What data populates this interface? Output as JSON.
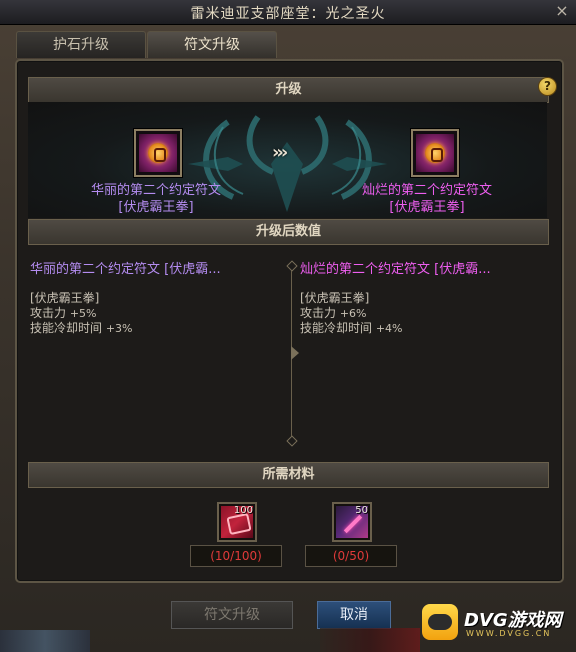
{
  "window": {
    "title": "雷米迪亚支部座堂：光之圣火"
  },
  "tabs": [
    {
      "label": "护石升级",
      "active": false
    },
    {
      "label": "符文升级",
      "active": true
    }
  ],
  "sections": {
    "upgrade": "升级",
    "after": "升级后数值",
    "materials": "所需材料"
  },
  "help_label": "?",
  "arrows": "›››",
  "source_item": {
    "name_lines": [
      "华丽的第二个约定符文",
      "[伏虎霸王拳]"
    ],
    "color": "#b48cf0",
    "preview_name": "华丽的第二个约定符文 [伏虎霸...",
    "skill": "[伏虎霸王拳]",
    "stats": [
      {
        "label": "攻击力",
        "value": "+5%"
      },
      {
        "label": "技能冷却时间",
        "value": "+3%"
      }
    ]
  },
  "target_item": {
    "name_lines": [
      "灿烂的第二个约定符文",
      "[伏虎霸王拳]"
    ],
    "color": "#ee5ef0",
    "preview_name": "灿烂的第二个约定符文 [伏虎霸...",
    "skill": "[伏虎霸王拳]",
    "stats": [
      {
        "label": "攻击力",
        "value": "+6%"
      },
      {
        "label": "技能冷却时间",
        "value": "+4%"
      }
    ]
  },
  "materials": [
    {
      "icon": "red-shard-icon",
      "stack": "100",
      "count": "(10/100)"
    },
    {
      "icon": "purple-crystal-icon",
      "stack": "50",
      "count": "(0/50)"
    }
  ],
  "buttons": {
    "upgrade": "符文升级",
    "cancel": "取消"
  },
  "watermark": {
    "brand": "DVG游戏网",
    "url": "WWW.DVGG.CN"
  },
  "colors": {
    "count_insufficient": "#e03a3a",
    "cancel_button": "#163152"
  }
}
